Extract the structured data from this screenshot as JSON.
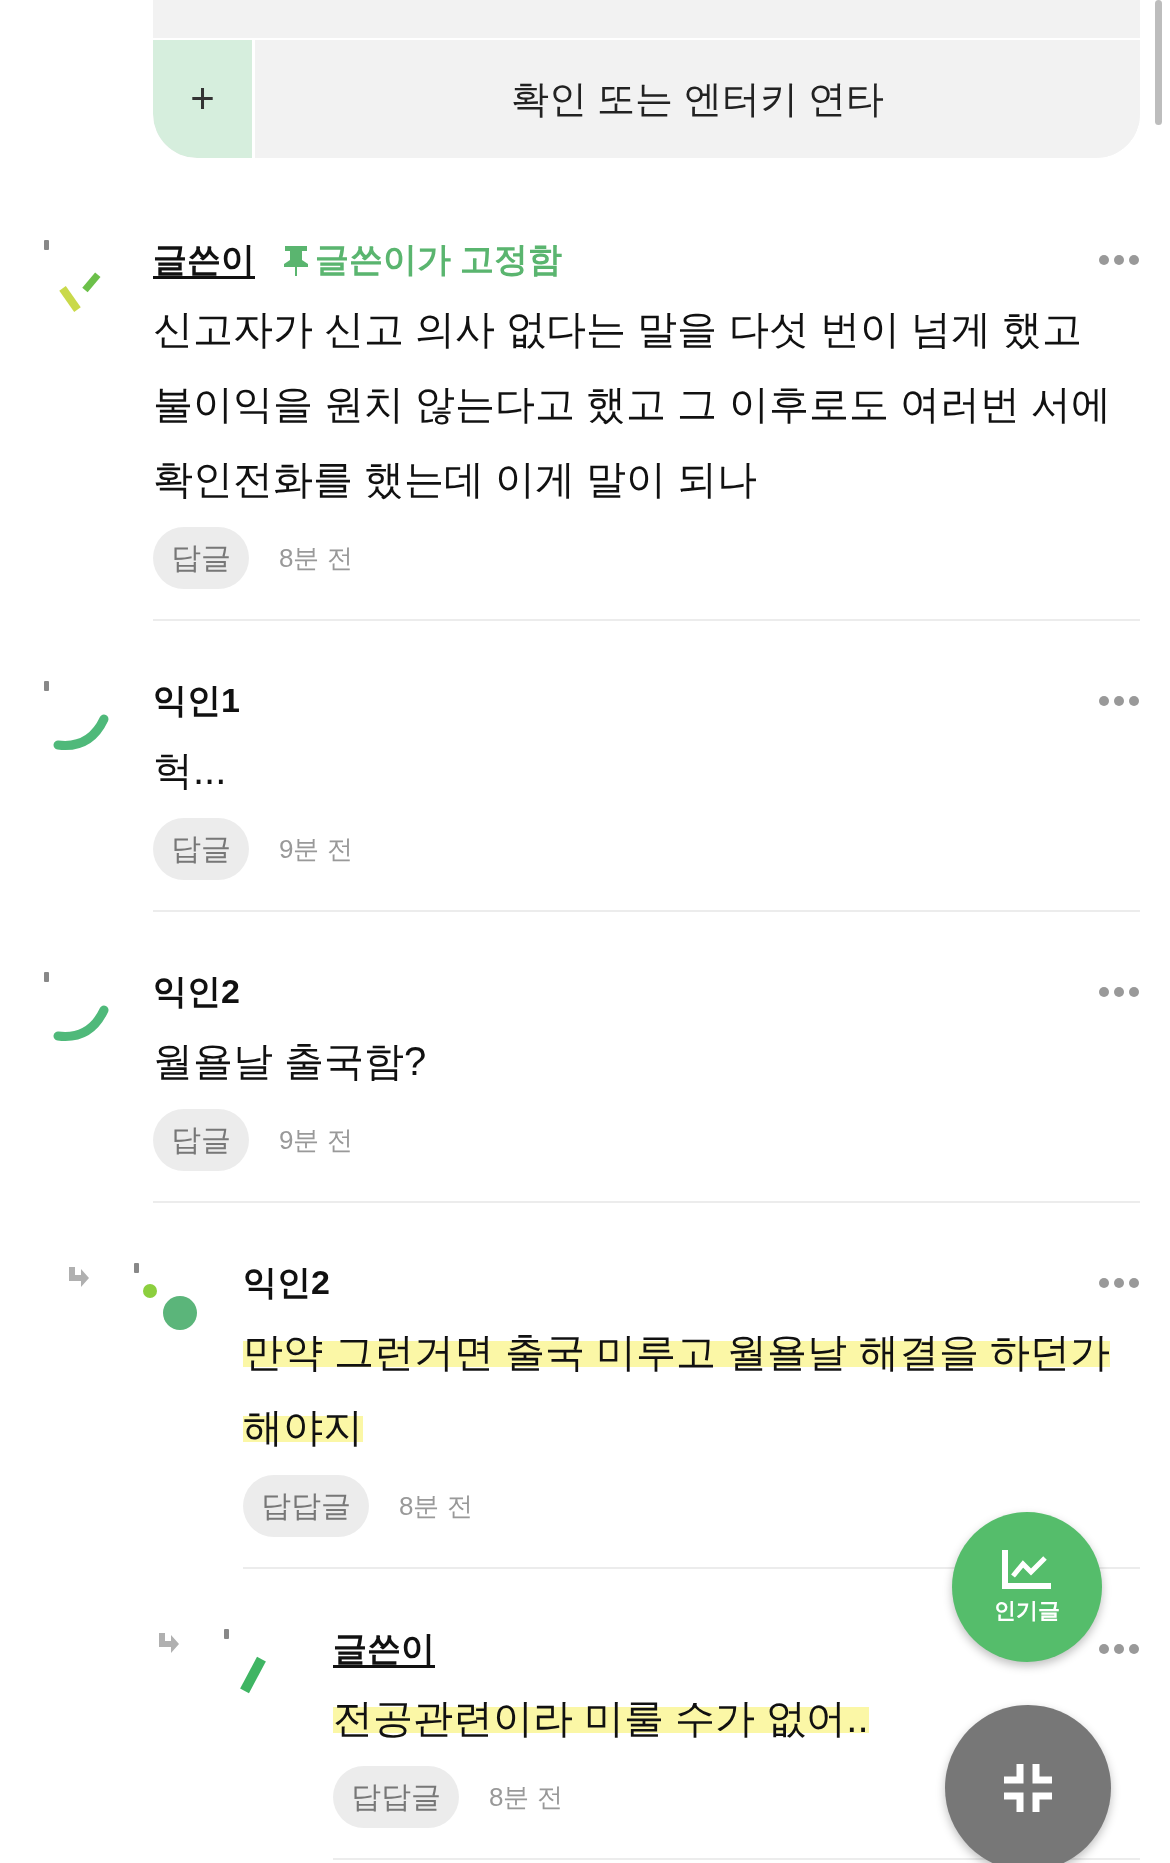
{
  "composer": {
    "add_label": "+",
    "submit_label": "확인 또는 엔터키 연타"
  },
  "comments": [
    {
      "author": "글쓴이",
      "is_author": true,
      "pinned_label": "글쓴이가 고정함",
      "body": "신고자가 신고 의사 없다는 말을 다섯 번이 넘게 했고 불이익을 원치 않는다고 했고 그 이후로도 여러번 서에 확인전화를 했는데 이게 말이 되나",
      "highlighted": false,
      "reply_label": "답글",
      "time": "8분 전"
    },
    {
      "author": "익인1",
      "is_author": false,
      "body": "헉...",
      "highlighted": false,
      "reply_label": "답글",
      "time": "9분 전"
    },
    {
      "author": "익인2",
      "is_author": false,
      "body": "월욜날 출국함?",
      "highlighted": false,
      "reply_label": "답글",
      "time": "9분 전",
      "children": [
        {
          "author": "익인2",
          "is_author": false,
          "body": "만약 그런거면 출국 미루고 월욜날 해결을 하던가 해야지",
          "highlighted": true,
          "reply_label": "답답글",
          "time": "8분 전",
          "children": [
            {
              "author": "글쓴이",
              "is_author": true,
              "body": "전공관련이라 미룰 수가 없어..",
              "highlighted": true,
              "reply_label": "답답글",
              "time": "8분 전"
            }
          ]
        }
      ]
    }
  ],
  "fab": {
    "popular_label": "인기글"
  }
}
